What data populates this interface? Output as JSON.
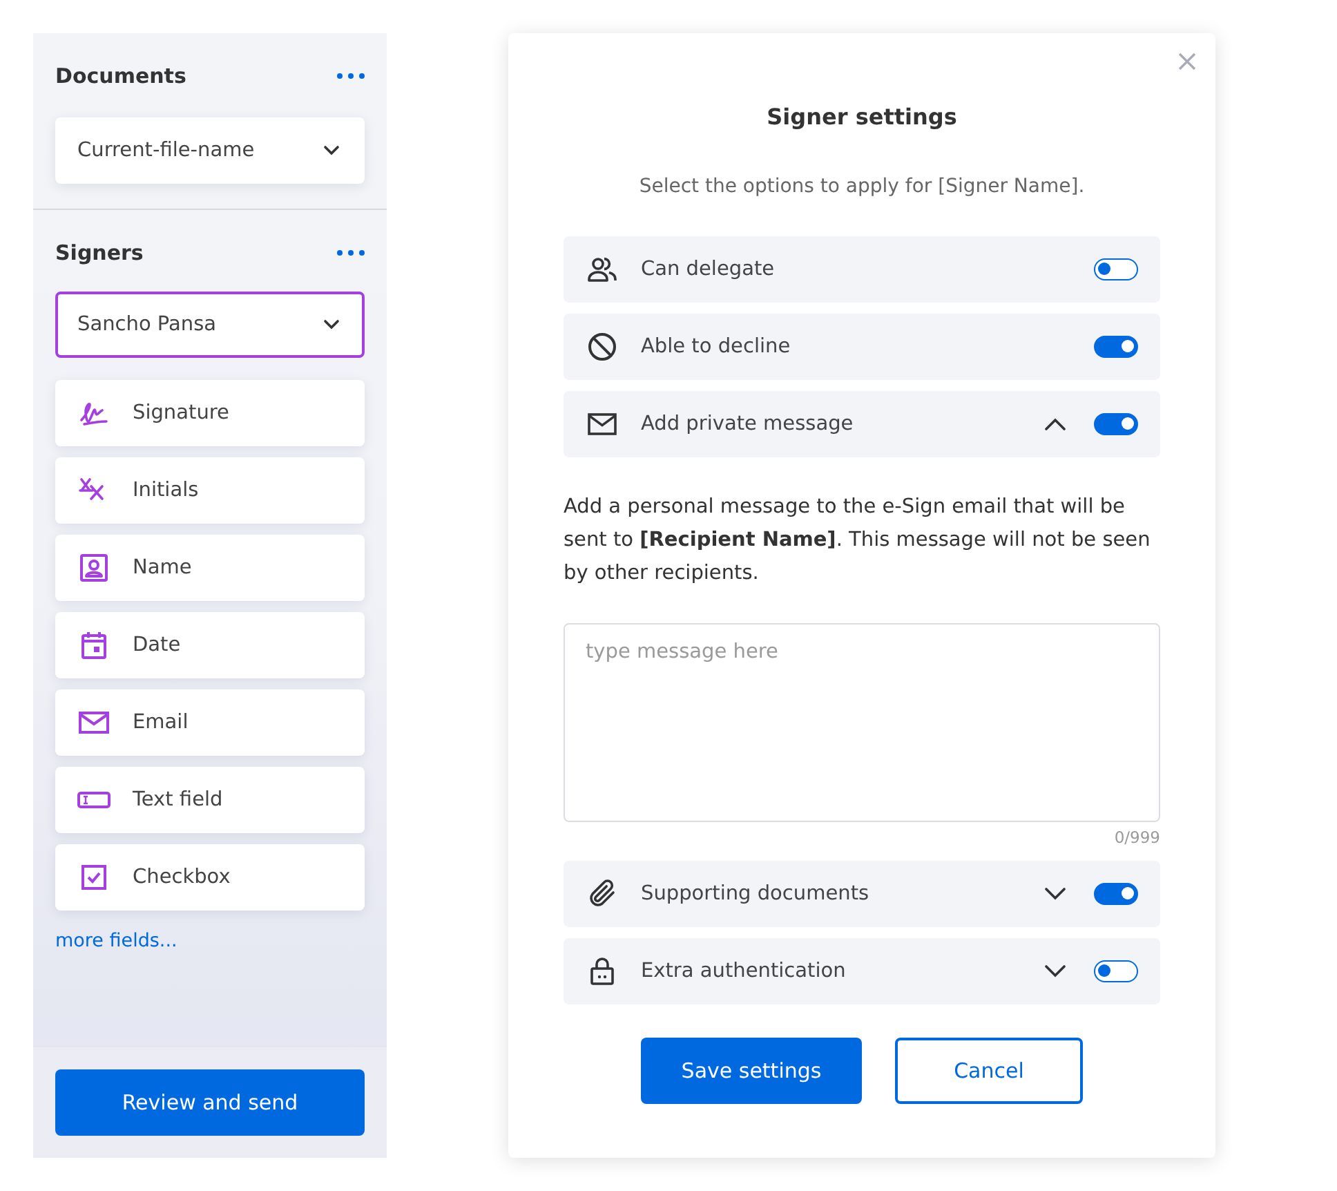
{
  "sidebar": {
    "documents": {
      "title": "Documents",
      "dropdown": {
        "value": "Current-file-name",
        "focused": false
      }
    },
    "signers": {
      "title": "Signers",
      "dropdown": {
        "value": "Sancho Pansa",
        "focused": true
      }
    },
    "fields": [
      {
        "kind": "signature",
        "label": "Signature"
      },
      {
        "kind": "initials",
        "label": "Initials"
      },
      {
        "kind": "name",
        "label": "Name"
      },
      {
        "kind": "date",
        "label": "Date"
      },
      {
        "kind": "email",
        "label": "Email"
      },
      {
        "kind": "text",
        "label": "Text field"
      },
      {
        "kind": "checkbox",
        "label": "Checkbox"
      }
    ],
    "more_fields_link": "more fields...",
    "review_button": "Review and send"
  },
  "dialog": {
    "title": "Signer settings",
    "subtitle": "Select the options to apply for [Signer Name].",
    "options": [
      {
        "kind": "switch",
        "label": "Can delegate",
        "on": false
      },
      {
        "kind": "switch",
        "label": "Able to decline",
        "on": true
      },
      {
        "kind": "expandable",
        "label": "Add private message",
        "on": true,
        "expanded": true,
        "panel": {
          "description": "Add a personal message to the e-Sign email that will be sent to **[Recipient Name]**. This message will not be seen by other recipients.",
          "placeholder": "type message here",
          "counter": "0/999"
        }
      },
      {
        "kind": "expandable",
        "label": "Supporting documents",
        "on": true,
        "expanded": false
      },
      {
        "kind": "expandable",
        "label": "Extra authentication",
        "on": false,
        "expanded": false
      }
    ],
    "buttons": [
      {
        "kind": "primary",
        "label": "Save settings"
      },
      {
        "kind": "secondary",
        "label": "Cancel"
      }
    ]
  }
}
